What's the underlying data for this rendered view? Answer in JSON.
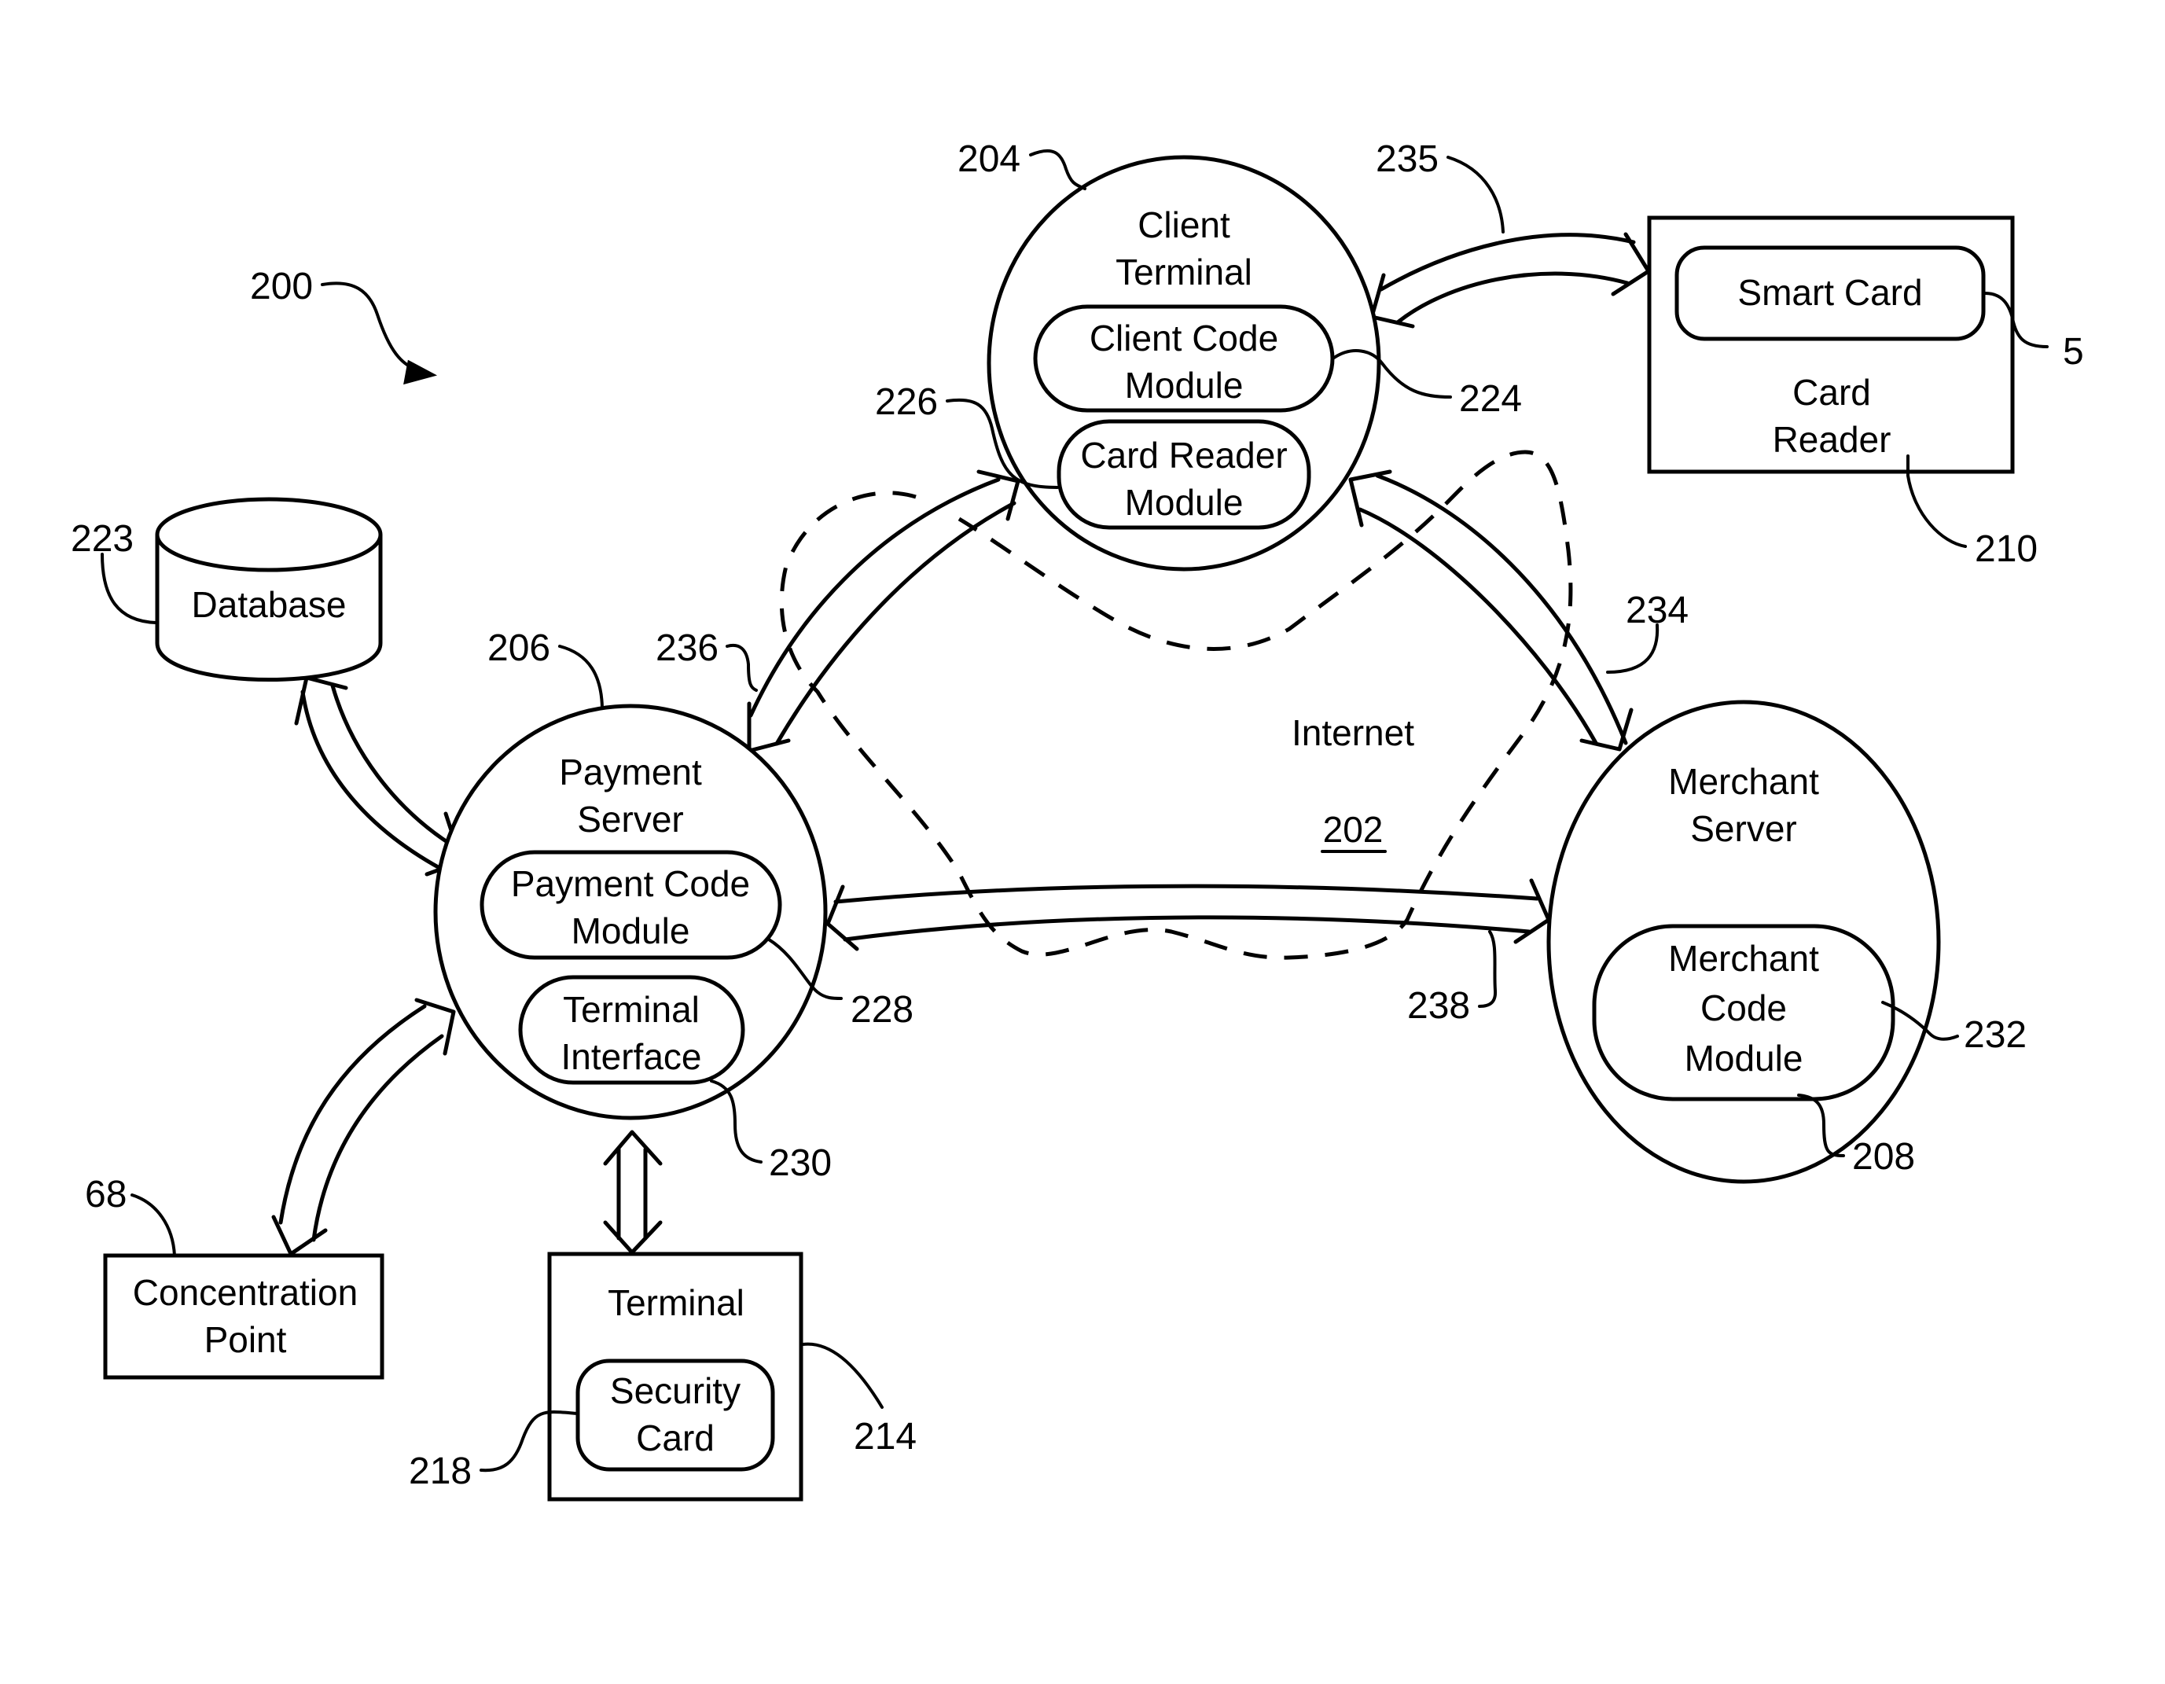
{
  "figure": {
    "ref": "200",
    "internet": {
      "label": "Internet",
      "ref": "202"
    }
  },
  "nodes": {
    "client_terminal": {
      "title_line1": "Client",
      "title_line2": "Terminal",
      "ref": "204",
      "modules": {
        "client_code": {
          "line1": "Client Code",
          "line2": "Module",
          "ref": "224"
        },
        "card_reader": {
          "line1": "Card Reader",
          "line2": "Module",
          "ref": "226"
        }
      }
    },
    "payment_server": {
      "title_line1": "Payment",
      "title_line2": "Server",
      "ref": "206",
      "modules": {
        "payment_code": {
          "line1": "Payment Code",
          "line2": "Module",
          "ref": "228"
        },
        "terminal_interface": {
          "line1": "Terminal",
          "line2": "Interface",
          "ref": "230"
        }
      }
    },
    "merchant_server": {
      "title_line1": "Merchant",
      "title_line2": "Server",
      "ref": "208",
      "modules": {
        "merchant_code": {
          "line1": "Merchant",
          "line2": "Code",
          "line3": "Module",
          "ref": "232"
        }
      }
    },
    "card_reader": {
      "title_line1": "Card",
      "title_line2": "Reader",
      "ref": "210",
      "smart_card": {
        "label": "Smart Card",
        "ref": "5"
      }
    },
    "database": {
      "label": "Database",
      "ref": "223"
    },
    "concentration_point": {
      "line1": "Concentration",
      "line2": "Point",
      "ref": "68"
    },
    "terminal": {
      "title": "Terminal",
      "ref": "214",
      "security_card": {
        "line1": "Security",
        "line2": "Card",
        "ref": "218"
      }
    }
  },
  "connections": {
    "client_to_card_reader": {
      "ref": "235"
    },
    "client_to_merchant": {
      "ref": "234"
    },
    "payment_to_client": {
      "ref": "236"
    },
    "payment_to_merchant": {
      "ref": "238"
    }
  }
}
